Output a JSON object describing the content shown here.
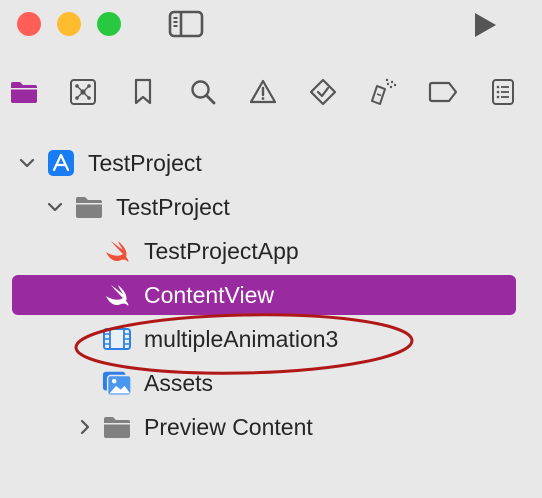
{
  "window": {
    "controls": [
      "close",
      "minimize",
      "zoom"
    ],
    "toolbar": {
      "sidebar_icon": "sidebar-left-icon",
      "run_icon": "play-icon"
    }
  },
  "navigator_tabs": [
    {
      "icon": "folder-icon",
      "active": true
    },
    {
      "icon": "source-control-icon",
      "active": false
    },
    {
      "icon": "bookmark-icon",
      "active": false
    },
    {
      "icon": "search-icon",
      "active": false
    },
    {
      "icon": "warning-icon",
      "active": false
    },
    {
      "icon": "test-icon",
      "active": false
    },
    {
      "icon": "debug-icon",
      "active": false
    },
    {
      "icon": "breakpoint-icon",
      "active": false
    },
    {
      "icon": "report-icon",
      "active": false
    }
  ],
  "tree": {
    "project": {
      "label": "TestProject",
      "icon": "xcode-app-icon",
      "expanded": true
    },
    "group": {
      "label": "TestProject",
      "icon": "folder-icon",
      "expanded": true
    },
    "items": [
      {
        "label": "TestProjectApp",
        "icon": "swift-icon",
        "selected": false
      },
      {
        "label": "ContentView",
        "icon": "swift-icon",
        "selected": true
      },
      {
        "label": "multipleAnimation3",
        "icon": "video-file-icon",
        "selected": false
      },
      {
        "label": "Assets",
        "icon": "asset-catalog-icon",
        "selected": false
      }
    ],
    "preview": {
      "label": "Preview Content",
      "icon": "folder-icon",
      "expanded": false
    }
  },
  "colors": {
    "background": "#e9e8e9",
    "selection": "#9a2a9f",
    "accent_icon": "#9a2a9f",
    "annotation": "#b01818"
  }
}
